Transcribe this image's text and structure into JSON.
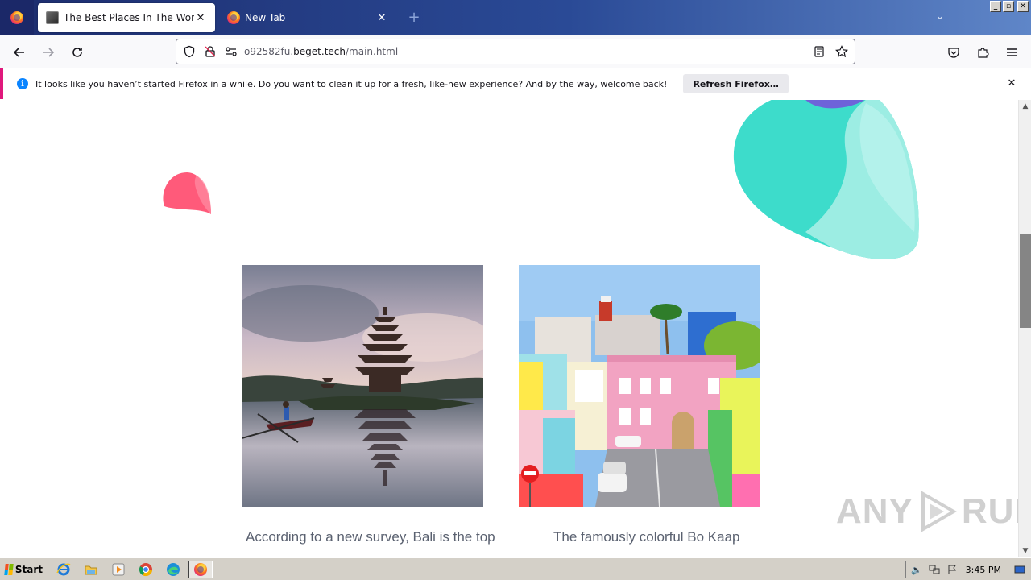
{
  "browser": {
    "tabs": [
      {
        "title": "The Best Places In The World",
        "active": true
      },
      {
        "title": "New Tab",
        "active": false
      }
    ],
    "url": {
      "prefix": "o92582fu.",
      "host": "beget.tech",
      "path": "/main.html"
    },
    "notification": {
      "message": "It looks like you haven’t started Firefox in a while. Do you want to clean it up for a fresh, like-new experience? And by the way, welcome back!",
      "button": "Refresh Firefox…"
    }
  },
  "page": {
    "cards": [
      {
        "image": "bali-temple-lake-photo",
        "caption": "According to a new survey, Bali is the top"
      },
      {
        "image": "bo-kaap-colorful-houses-photo",
        "caption": "The famously colorful Bo Kaap"
      }
    ],
    "blob_colors": {
      "pink": "#ff5a7a",
      "teal": "#3ddccb",
      "teal_light": "#9cede3",
      "purple": "#6e63d9"
    }
  },
  "watermark": {
    "left": "ANY",
    "right": "RUN"
  },
  "taskbar": {
    "start_label": "Start",
    "pinned": [
      "ie-icon",
      "explorer-icon",
      "media-player-icon",
      "chrome-icon",
      "edge-icon",
      "firefox-icon"
    ],
    "clock": "3:45 PM"
  }
}
